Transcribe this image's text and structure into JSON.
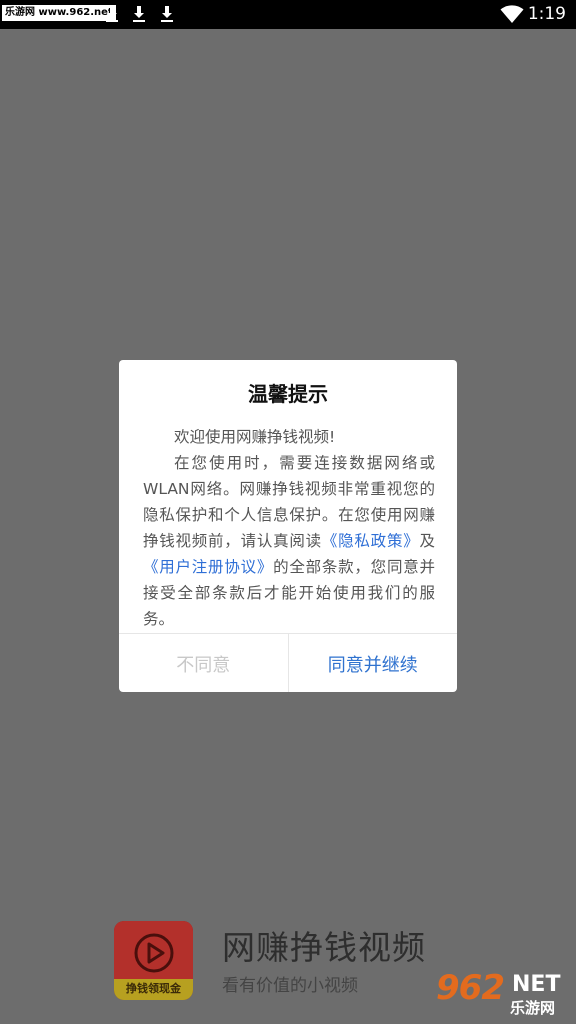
{
  "status_bar": {
    "site_tag": "乐游网 www.962.net",
    "time": "1:19",
    "icons": [
      "download-icon",
      "download-icon",
      "download-icon",
      "wifi-icon"
    ]
  },
  "dialog": {
    "title": "温馨提示",
    "greeting": "欢迎使用网赚挣钱视频!",
    "body_part1": "在您使用时，需要连接数据网络或WLAN网络。网赚挣钱视频非常重视您的隐私保护和个人信息保护。在您使用网赚挣钱视频前，请认真阅读",
    "privacy_link": "《隐私政策》",
    "conjunction": "及",
    "agreement_link": "《用户注册协议》",
    "body_part2": "的全部条款，您同意并接受全部条款后才能开始使用我们的服务。",
    "decline_label": "不同意",
    "accept_label": "同意并继续"
  },
  "splash": {
    "logo_caption": "挣钱领现金",
    "app_name": "网赚挣钱视频",
    "slogan": "看有价值的小视频"
  },
  "watermark": {
    "number": "962",
    "net": "NET",
    "site": "乐游网"
  },
  "colors": {
    "overlay": "#6d6d6d",
    "link": "#2f6fd6",
    "accept": "#2f72cf",
    "decline": "#c8c8c8"
  }
}
